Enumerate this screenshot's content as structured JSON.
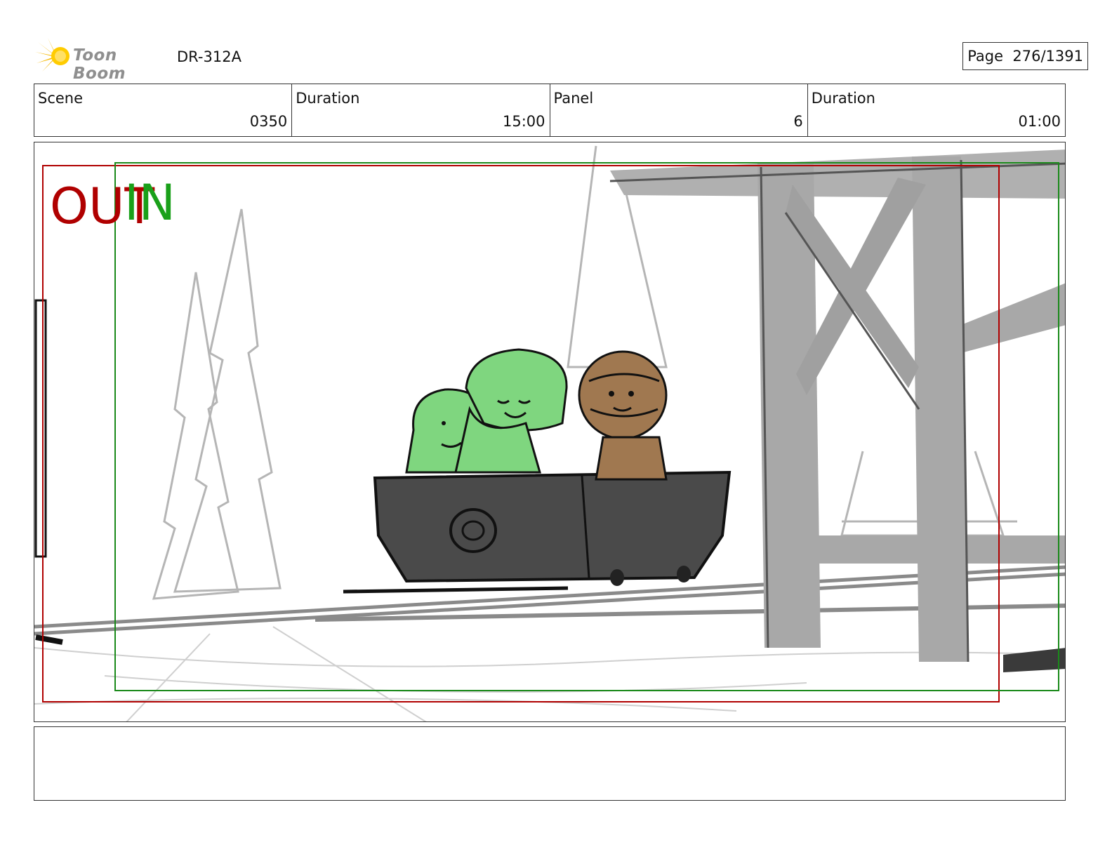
{
  "header": {
    "logo_text": "Toon Boom",
    "project_id": "DR-312A",
    "page_label": "Page",
    "page_value": "276/1391"
  },
  "info": [
    {
      "label": "Scene",
      "value": "0350"
    },
    {
      "label": "Duration",
      "value": "15:00"
    },
    {
      "label": "Panel",
      "value": "6"
    },
    {
      "label": "Duration",
      "value": "01:00"
    }
  ],
  "panel": {
    "out_label": "OUT",
    "in_label": "IN",
    "colors": {
      "out_frame": "#b00000",
      "in_frame": "#1a8a1a",
      "cart": "#4a4a4a",
      "green_character": "#7fd67f",
      "brown_character": "#a07850",
      "scaffold": "#a8a8a8"
    }
  },
  "notes": {
    "text": ""
  }
}
